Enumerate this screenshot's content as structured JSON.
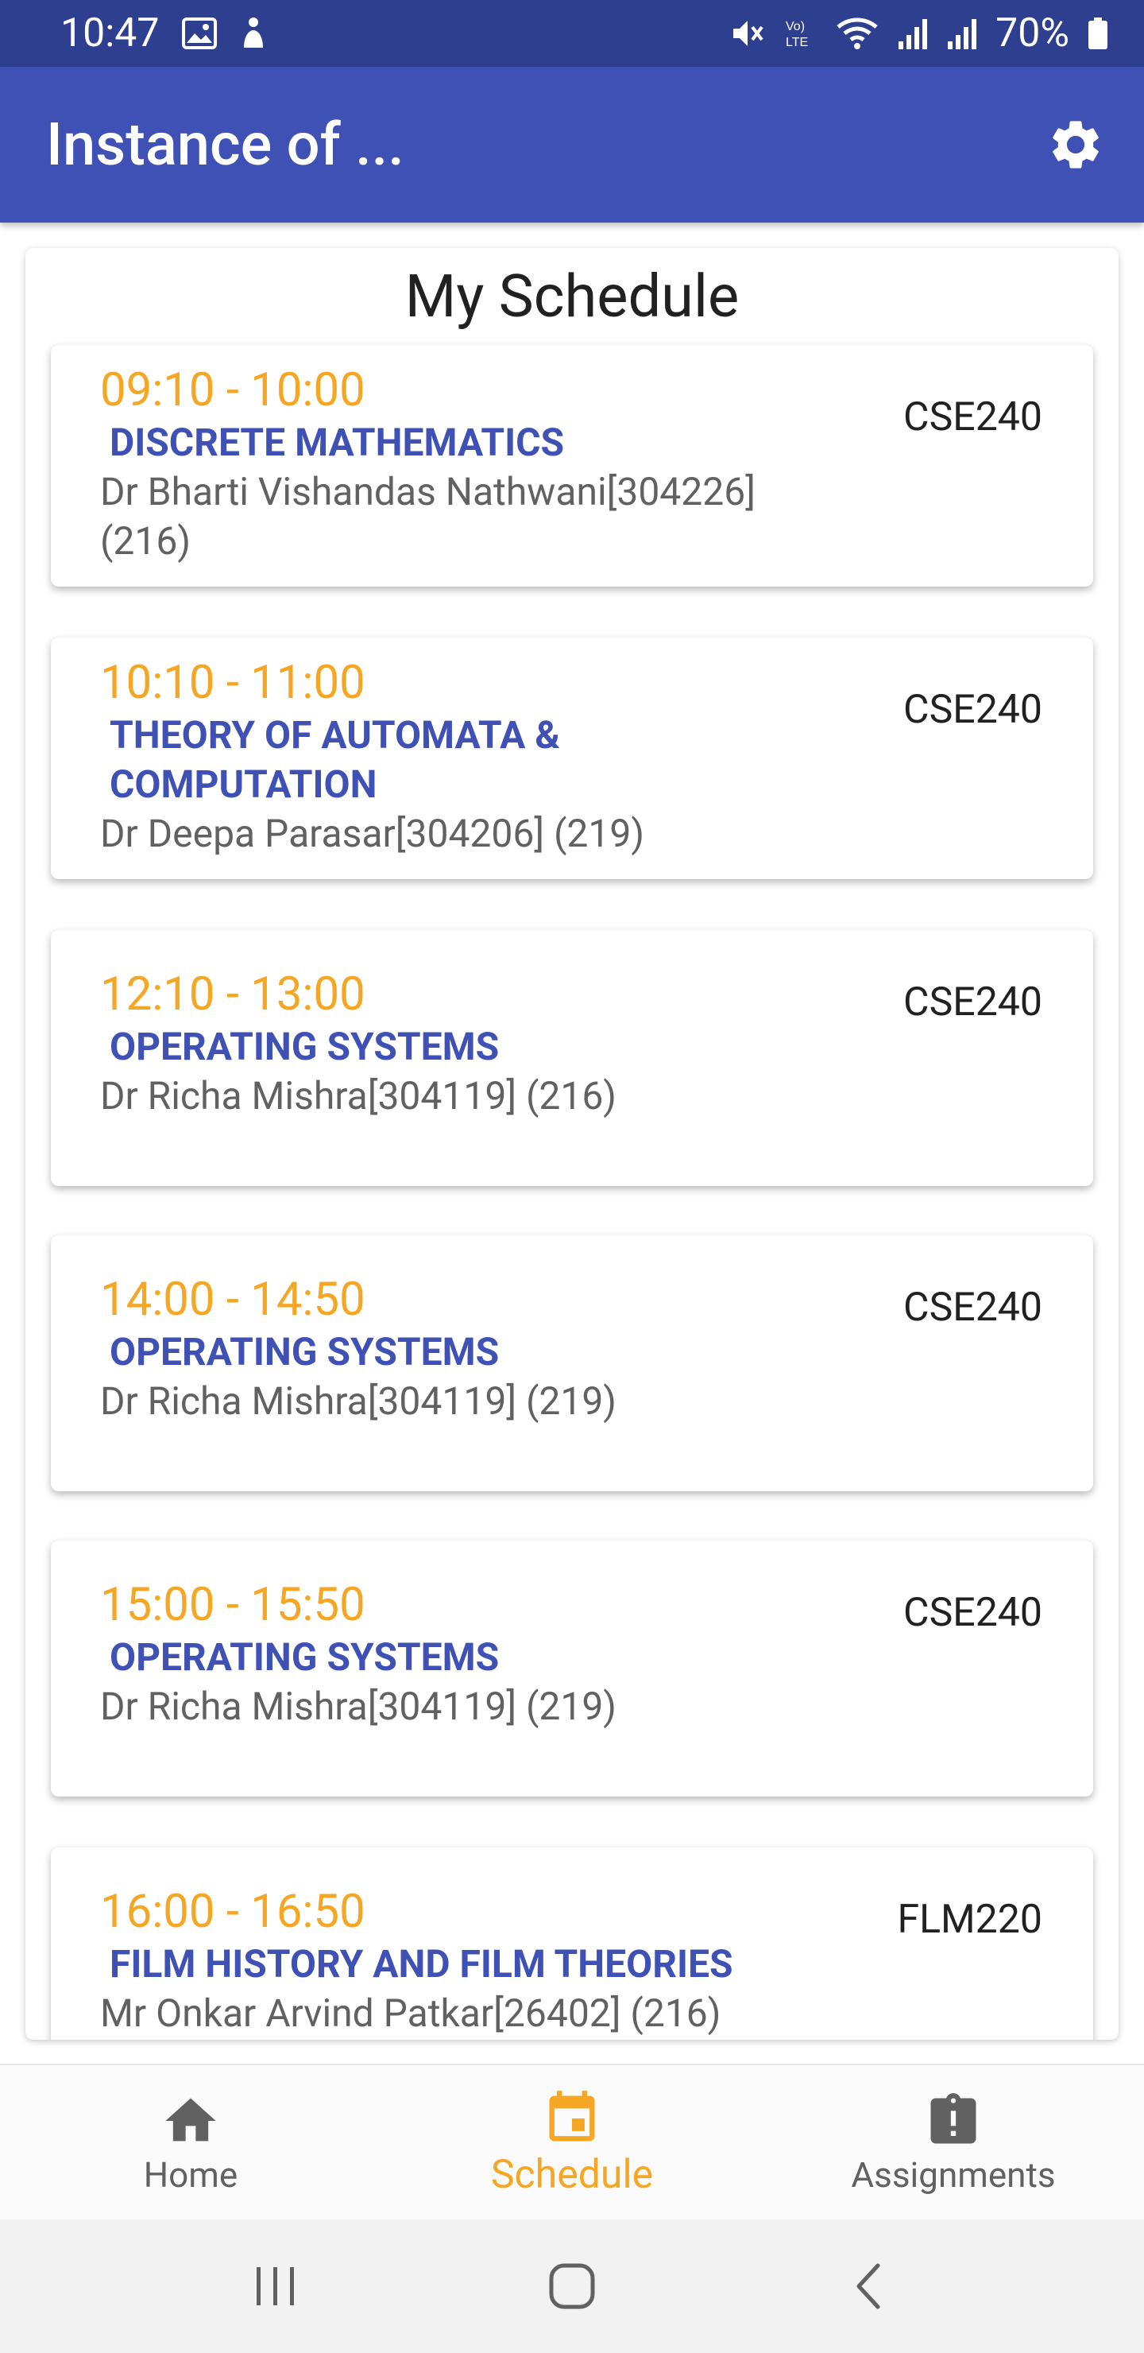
{
  "status_bar": {
    "time": "10:47",
    "battery": "70%",
    "icons": [
      "image-icon",
      "accessibility-icon",
      "mute-icon",
      "volte-icon",
      "wifi-icon",
      "signal-icon",
      "signal-icon",
      "battery-icon"
    ]
  },
  "app_bar": {
    "title": "Instance of ...",
    "settings_icon": "gear-icon"
  },
  "schedule": {
    "title": "My Schedule",
    "items": [
      {
        "time": "09:10 - 10:00",
        "subject": "DISCRETE MATHEMATICS",
        "teacher": "Dr Bharti Vishandas Nathwani[304226] (216)",
        "code": "CSE240"
      },
      {
        "time": "10:10 - 11:00",
        "subject": "THEORY OF AUTOMATA & COMPUTATION",
        "teacher": "Dr Deepa Parasar[304206] (219)",
        "code": "CSE240"
      },
      {
        "time": "12:10 - 13:00",
        "subject": "OPERATING SYSTEMS",
        "teacher": "Dr Richa Mishra[304119] (216)",
        "code": "CSE240"
      },
      {
        "time": "14:00 - 14:50",
        "subject": "OPERATING SYSTEMS",
        "teacher": "Dr Richa Mishra[304119] (219)",
        "code": "CSE240"
      },
      {
        "time": "15:00 - 15:50",
        "subject": "OPERATING SYSTEMS",
        "teacher": "Dr Richa Mishra[304119] (219)",
        "code": "CSE240"
      },
      {
        "time": "16:00 - 16:50",
        "subject": "FILM HISTORY AND FILM THEORIES",
        "teacher": "Mr Onkar Arvind Patkar[26402] (216)",
        "code": "FLM220"
      }
    ]
  },
  "bottom_nav": {
    "items": [
      {
        "label": "Home",
        "icon": "home-icon",
        "active": false
      },
      {
        "label": "Schedule",
        "icon": "calendar-icon",
        "active": true
      },
      {
        "label": "Assignments",
        "icon": "assignment-icon",
        "active": false
      }
    ]
  },
  "system_nav": {
    "icons": [
      "recent-apps-icon",
      "home-circle-icon",
      "back-icon"
    ]
  },
  "colors": {
    "status_bar": "#2f3f8f",
    "primary": "#3f51b5",
    "accent": "#f5a623",
    "teacher_text": "#616161"
  }
}
